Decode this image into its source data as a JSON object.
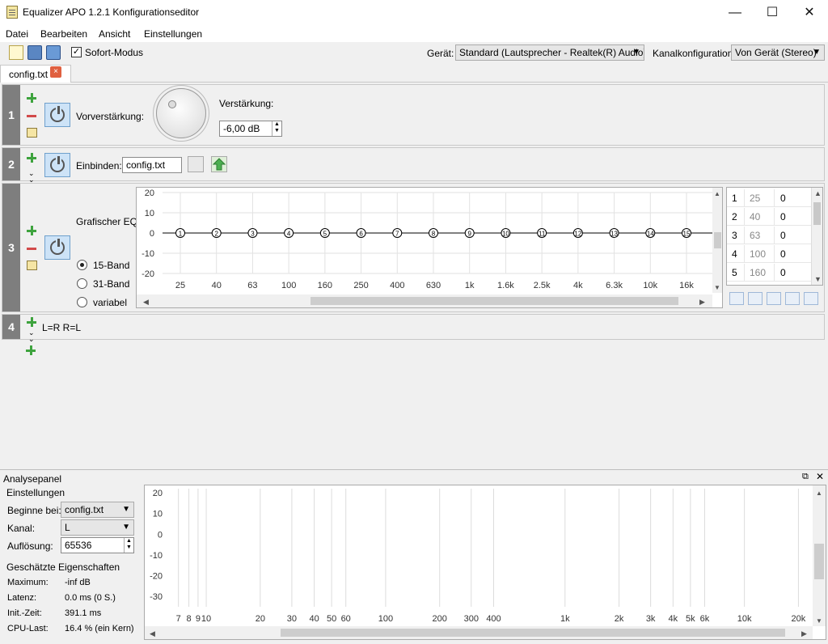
{
  "window": {
    "title": "Equalizer APO 1.2.1 Konfigurationseditor",
    "minimize": "—",
    "maximize": "☐",
    "close": "✕"
  },
  "menu": [
    "Datei",
    "Bearbeiten",
    "Ansicht",
    "Einstellungen"
  ],
  "toolbar": {
    "instant_mode_label": "Sofort-Modus",
    "instant_mode_checked": "✓",
    "device_label": "Gerät:",
    "device_value": "Standard (Lautsprecher - Realtek(R) Audio)",
    "channel_config_label": "Kanalkonfiguration:",
    "channel_config_value": "Von Gerät (Stereo)"
  },
  "tabs": [
    {
      "label": "config.txt",
      "close": "×"
    }
  ],
  "rows": {
    "r1": {
      "number": "1",
      "preamp_label": "Vorverstärkung:",
      "gain_label": "Verstärkung:",
      "gain_value": "-6,00 dB"
    },
    "r2": {
      "number": "2",
      "include_label": "Einbinden:",
      "include_value": "config.txt"
    },
    "r3": {
      "number": "3",
      "eq_label": "Grafischer EQ:",
      "modes": [
        "15-Band",
        "31-Band",
        "variabel"
      ]
    },
    "r4": {
      "number": "4",
      "text": "L=R R=L"
    }
  },
  "eq": {
    "y_ticks": [
      "20",
      "10",
      "0",
      "-10",
      "-20"
    ],
    "x_ticks": [
      "25",
      "40",
      "63",
      "100",
      "160",
      "250",
      "400",
      "630",
      "1k",
      "1.6k",
      "2.5k",
      "4k",
      "6.3k",
      "10k",
      "16k"
    ],
    "band_ids": [
      "1",
      "2",
      "3",
      "4",
      "5",
      "6",
      "7",
      "8",
      "9",
      "10",
      "11",
      "12",
      "13",
      "14",
      "15"
    ],
    "gains": [
      0,
      0,
      0,
      0,
      0,
      0,
      0,
      0,
      0,
      0,
      0,
      0,
      0,
      0,
      0
    ],
    "table": [
      {
        "idx": "1",
        "freq": "25",
        "gain": "0"
      },
      {
        "idx": "2",
        "freq": "40",
        "gain": "0"
      },
      {
        "idx": "3",
        "freq": "63",
        "gain": "0"
      },
      {
        "idx": "4",
        "freq": "100",
        "gain": "0"
      },
      {
        "idx": "5",
        "freq": "160",
        "gain": "0"
      }
    ]
  },
  "analysis": {
    "title": "Analysepanel",
    "settings_title": "Einstellungen",
    "start_label": "Beginne bei:",
    "start_value": "config.txt",
    "channel_label": "Kanal:",
    "channel_value": "L",
    "resolution_label": "Auflösung:",
    "resolution_value": "65536",
    "props_title": "Geschätzte Eigenschaften",
    "props": [
      {
        "key": "Maximum:",
        "value": "-inf dB"
      },
      {
        "key": "Latenz:",
        "value": "0.0 ms (0 S.)"
      },
      {
        "key": "Init.-Zeit:",
        "value": "391.1 ms"
      },
      {
        "key": "CPU-Last:",
        "value": "16.4 % (ein Kern)"
      }
    ],
    "y_ticks": [
      "20",
      "10",
      "0",
      "-10",
      "-20",
      "-30"
    ],
    "x_ticks": [
      "7",
      "8",
      "9",
      "10",
      "20",
      "30",
      "40",
      "50",
      "60",
      "100",
      "200",
      "300",
      "400",
      "1k",
      "2k",
      "3k",
      "4k",
      "5k",
      "6k",
      "10k",
      "20k"
    ]
  }
}
